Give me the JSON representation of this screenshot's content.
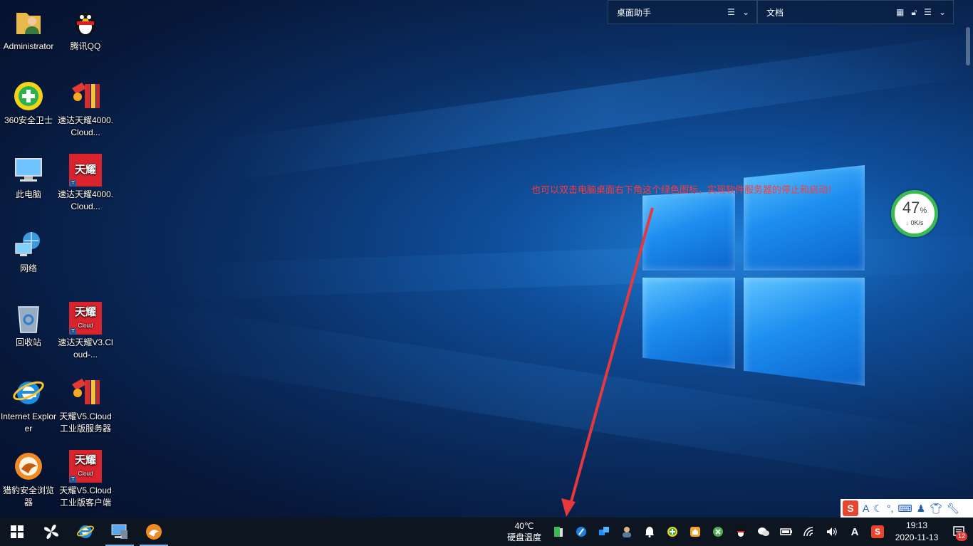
{
  "desktop_icons": [
    {
      "label": "Administrator",
      "icon": "user-folder-icon"
    },
    {
      "label": "腾讯QQ",
      "icon": "qq-penguin-icon"
    },
    {
      "label": "360安全卫士",
      "icon": "360-security-icon"
    },
    {
      "label": "速达天耀4000.Cloud...",
      "icon": "suda-server-icon"
    },
    {
      "label": "此电脑",
      "icon": "computer-icon"
    },
    {
      "label": "速达天耀4000.Cloud...",
      "icon": "tianyao-red-icon"
    },
    {
      "label": "网络",
      "icon": "network-icon"
    },
    {
      "label": "回收站",
      "icon": "recycle-bin-icon"
    },
    {
      "label": "速达天耀V3.Cloud-...",
      "icon": "tianyao-cloud-icon"
    },
    {
      "label": "Internet Explorer",
      "icon": "ie-icon"
    },
    {
      "label": "天耀V5.Cloud工业版服务器",
      "icon": "suda-server-icon"
    },
    {
      "label": "猎豹安全浏览器",
      "icon": "cheetah-browser-icon"
    },
    {
      "label": "天耀V5.Cloud工业版客户端",
      "icon": "tianyao-cloud-icon"
    }
  ],
  "tianyao_logo": {
    "top": "天耀",
    "sub": "Cloud",
    "t": "T"
  },
  "assistant": {
    "desktop_helper": "桌面助手",
    "documents": "文档"
  },
  "annotation": "也可以双击电脑桌面右下角这个绿色图标，实现软件服务器的停止和启动！",
  "speed_ball": {
    "percent": "47",
    "percent_unit": "%",
    "rate": "0K/s"
  },
  "ime_bar": {
    "a": "A"
  },
  "taskbar": {
    "temperature": "40℃",
    "temperature_label": "硬盘温度",
    "tray_a": "A",
    "time": "19:13",
    "date": "2020-11-13",
    "notification_count": "12"
  },
  "colors": {
    "annotation": "#ff3a3a",
    "arrow": "#e8383d",
    "speed_ring": "#3dbb52",
    "taskbar": "#0d1521"
  }
}
